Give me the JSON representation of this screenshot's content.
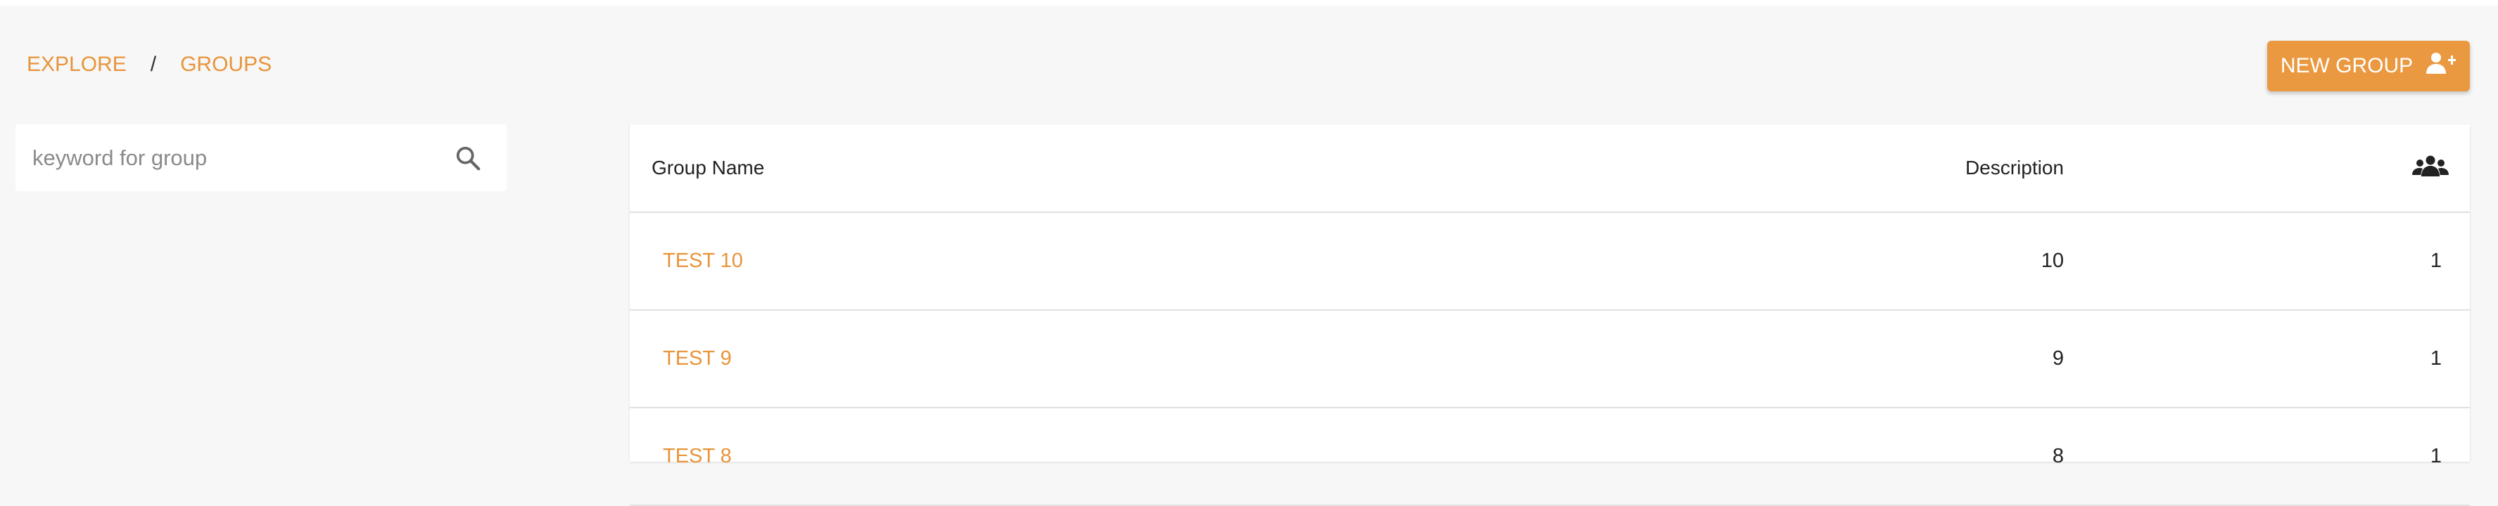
{
  "breadcrumb": {
    "items": [
      "EXPLORE",
      "GROUPS"
    ],
    "separator": "/"
  },
  "toolbar": {
    "new_group_label": "NEW GROUP",
    "new_group_icon": "person-add-icon"
  },
  "search": {
    "placeholder": "keyword for group",
    "value": "",
    "icon": "search-icon"
  },
  "table": {
    "headers": {
      "name": "Group Name",
      "description": "Description",
      "members_icon": "people-icon"
    },
    "rows": [
      {
        "name": "TEST 10",
        "description": "10",
        "members": "1"
      },
      {
        "name": "TEST 9",
        "description": "9",
        "members": "1"
      },
      {
        "name": "TEST 8",
        "description": "8",
        "members": "1"
      }
    ]
  },
  "colors": {
    "accent": "#eb9940",
    "link": "#e8943a",
    "background": "#f7f7f7",
    "card": "#ffffff",
    "divider": "#e0e0e0"
  }
}
